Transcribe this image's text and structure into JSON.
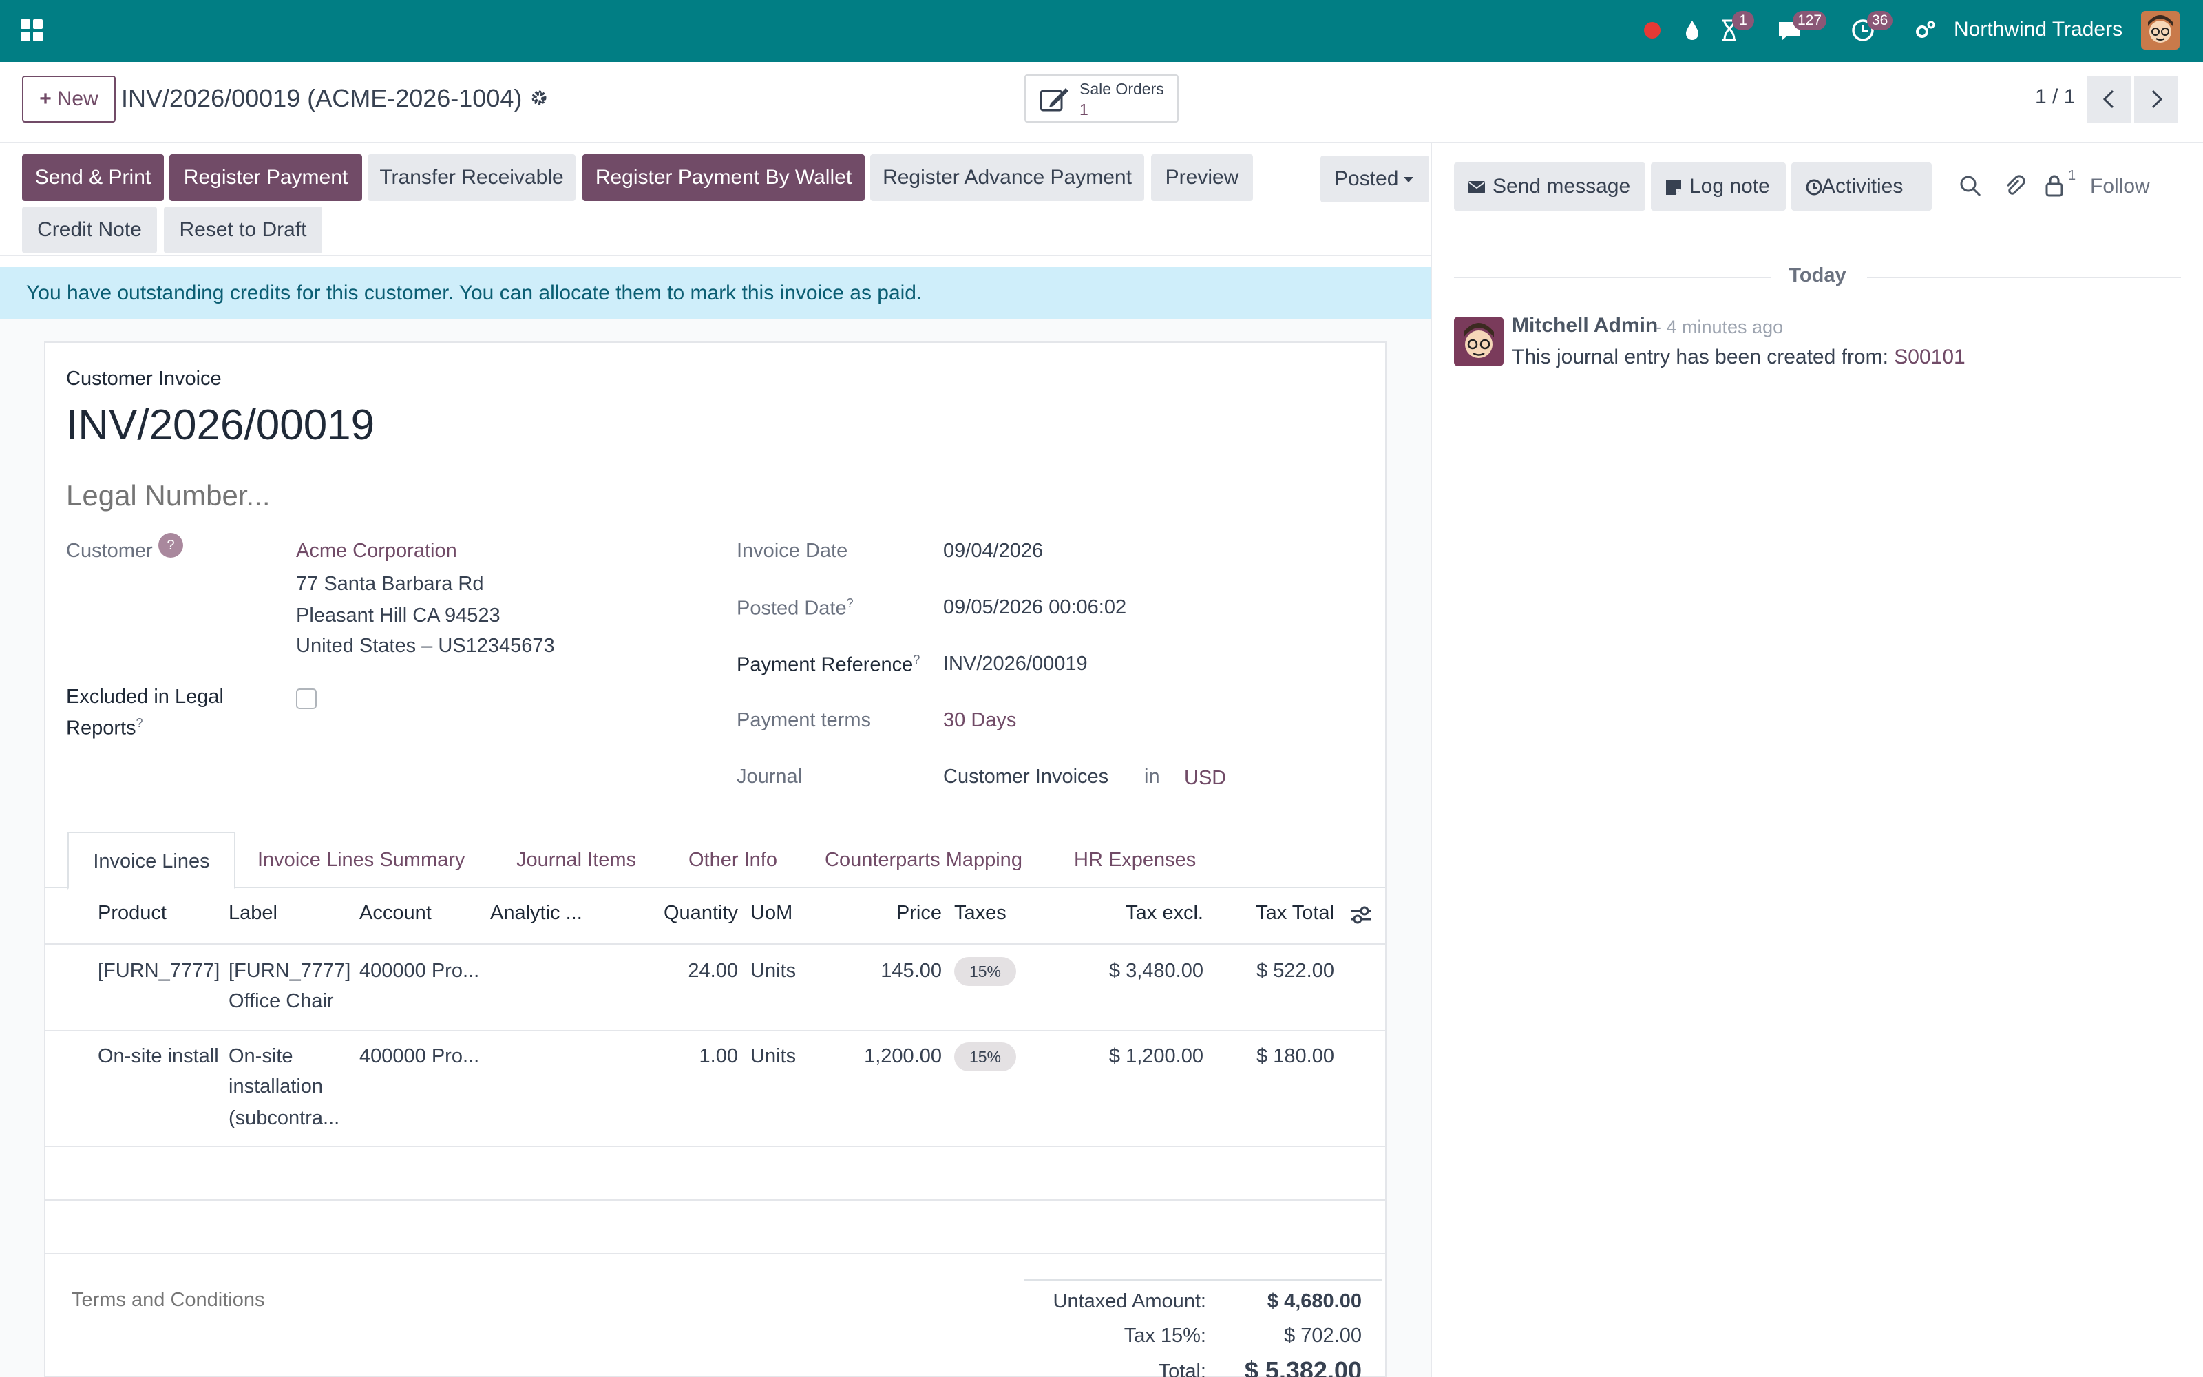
{
  "navbar": {
    "company": "Northwind Traders",
    "badges": {
      "activity": "1",
      "messages": "127",
      "clock": "36"
    }
  },
  "control_panel": {
    "new_label": "New",
    "breadcrumb": "INV/2026/00019 (ACME-2026-1004)",
    "smart_button": {
      "label": "Sale Orders",
      "count": "1"
    },
    "pager": "1 / 1"
  },
  "statusbar": {
    "buttons": [
      {
        "label": "Send & Print",
        "style": "primary"
      },
      {
        "label": "Register Payment",
        "style": "primary"
      },
      {
        "label": "Transfer Receivable",
        "style": "secondary"
      },
      {
        "label": "Register Payment By Wallet",
        "style": "primary"
      },
      {
        "label": "Register Advance Payment",
        "style": "secondary"
      },
      {
        "label": "Preview",
        "style": "secondary"
      },
      {
        "label": "Credit Note",
        "style": "secondary"
      },
      {
        "label": "Reset to Draft",
        "style": "secondary"
      }
    ],
    "state": "Posted"
  },
  "alert": {
    "prefix": "You have ",
    "link": "outstanding credits",
    "suffix": " for this customer. You can allocate them to mark this invoice as paid."
  },
  "form": {
    "move_type": "Customer Invoice",
    "name": "INV/2026/00019",
    "legal_number_placeholder": "Legal Number...",
    "customer_label": "Customer",
    "customer_help": "?",
    "customer_name": "Acme Corporation",
    "customer_address": [
      "77 Santa Barbara Rd",
      "Pleasant Hill CA 94523",
      "United States – US12345673"
    ],
    "excluded_label_line1": "Excluded in Legal",
    "excluded_label_line2": "Reports",
    "help_mark": "?",
    "invoice_date_label": "Invoice Date",
    "invoice_date": "09/04/2026",
    "posted_date_label": "Posted Date",
    "posted_date": "09/05/2026 00:06:02",
    "payment_reference_label": "Payment Reference",
    "payment_reference": "INV/2026/00019",
    "payment_terms_label": "Payment terms",
    "payment_terms": "30 Days",
    "journal_label": "Journal",
    "journal": "Customer Invoices",
    "journal_in": "in",
    "currency": "USD"
  },
  "tabs": [
    "Invoice Lines",
    "Invoice Lines Summary",
    "Journal Items",
    "Other Info",
    "Counterparts Mapping",
    "HR Expenses"
  ],
  "lines": {
    "headers": {
      "product": "Product",
      "label": "Label",
      "account": "Account",
      "analytic": "Analytic ...",
      "quantity": "Quantity",
      "uom": "UoM",
      "price": "Price",
      "taxes": "Taxes",
      "tax_excl": "Tax excl.",
      "tax_total": "Tax Total"
    },
    "rows": [
      {
        "product": "[FURN_7777] (",
        "label_lines": [
          "[FURN_7777]",
          "Office Chair"
        ],
        "account": "400000 Pro...",
        "quantity": "24.00",
        "uom": "Units",
        "price": "145.00",
        "tax": "15%",
        "tax_excl": "$ 3,480.00",
        "tax_total": "$ 522.00"
      },
      {
        "product": "On-site install",
        "label_lines": [
          "On-site",
          "installation",
          "(subcontra..."
        ],
        "account": "400000 Pro...",
        "quantity": "1.00",
        "uom": "Units",
        "price": "1,200.00",
        "tax": "15%",
        "tax_excl": "$ 1,200.00",
        "tax_total": "$ 180.00"
      }
    ]
  },
  "totals": {
    "terms_placeholder": "Terms and Conditions",
    "untaxed_label": "Untaxed Amount:",
    "untaxed": "$ 4,680.00",
    "tax_label": "Tax 15%:",
    "tax": "$ 702.00",
    "total_label": "Total:",
    "total": "$ 5,382.00"
  },
  "chatter": {
    "send_message": "Send message",
    "log_note": "Log note",
    "activities": "Activities",
    "follower_count": "1",
    "follow": "Follow",
    "today": "Today",
    "message": {
      "author": "Mitchell Admin",
      "time": "- 4 minutes ago",
      "body": "This journal entry has been created from: ",
      "link": "S00101"
    }
  },
  "colors": {
    "navbar": "#017e84",
    "primary": "#714b67",
    "alert_bg": "#cfeefa",
    "alert_text": "#0b5e73"
  }
}
